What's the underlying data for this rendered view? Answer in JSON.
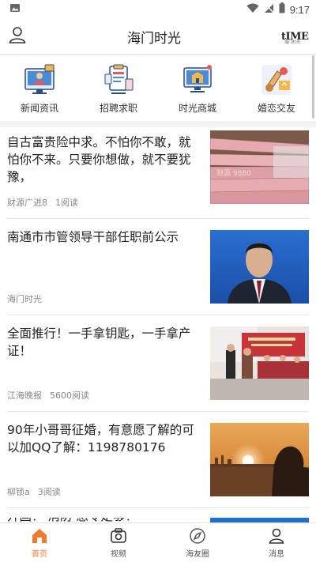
{
  "status_bar": {
    "time": "9:17"
  },
  "header": {
    "title": "海门时光",
    "brand_text": "tIME",
    "brand_sub": "海门时光"
  },
  "categories": [
    {
      "label": "新闻资讯",
      "icon": "news-icon"
    },
    {
      "label": "招聘求职",
      "icon": "recruit-icon"
    },
    {
      "label": "时光商城",
      "icon": "mall-icon"
    },
    {
      "label": "婚恋交友",
      "icon": "dating-icon"
    }
  ],
  "feed": [
    {
      "title": "自古富贵险中求。不怕你不敢，就怕你不来。只要你想做，就不要犹豫，",
      "source": "财源广进8",
      "reads": "1阅读",
      "thumb": "money-photo",
      "thumb_caption": "财源 9880"
    },
    {
      "title": "南通市市管领导干部任职前公示",
      "source": "海门时光",
      "reads": "",
      "thumb": "portrait-photo"
    },
    {
      "title": "全面推行！一手拿钥匙，一手拿产证！",
      "source": "江海晚报",
      "reads": "5600阅读",
      "thumb": "ceremony-photo"
    },
    {
      "title": "90年小哥哥征婚，有意愿了解的可以加QQ了解：1198780176",
      "source": "柳锁a",
      "reads": "3阅读",
      "thumb": "sunset-photo"
    }
  ],
  "partial": {
    "title": "开国？ 消防 急令足够！"
  },
  "bottom_nav": [
    {
      "label": "首页",
      "icon": "home-icon",
      "active": true
    },
    {
      "label": "视频",
      "icon": "video-icon",
      "active": false
    },
    {
      "label": "海友圈",
      "icon": "compass-icon",
      "active": false
    },
    {
      "label": "消息",
      "icon": "message-icon",
      "active": false
    }
  ],
  "colors": {
    "accent": "#f07a2b",
    "divider": "#e6e6e6",
    "section_gap": "#f4f4f4"
  }
}
